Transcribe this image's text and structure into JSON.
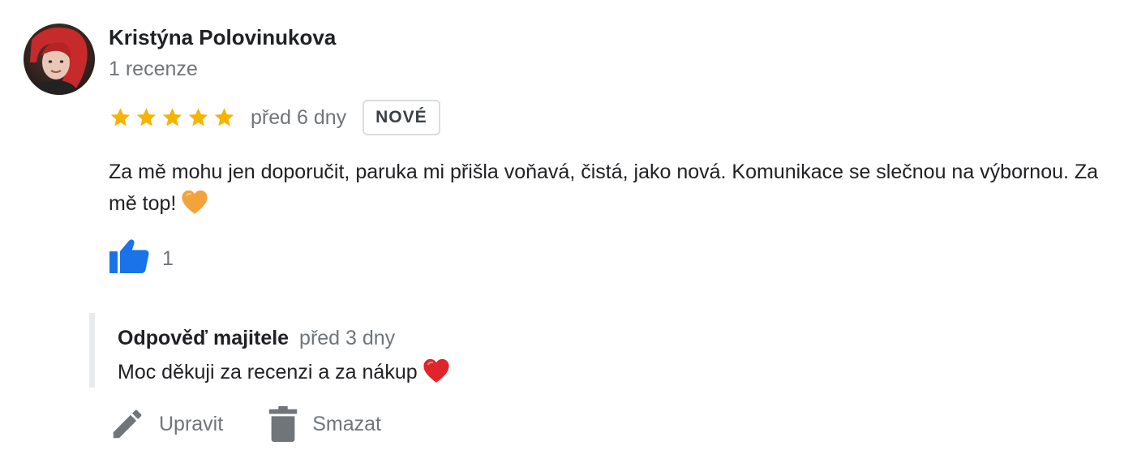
{
  "review": {
    "reviewer_name": "Kristýna Polovinukova",
    "review_count": "1 recenze",
    "rating": 5,
    "date": "před 6 dny",
    "badge": "NOVÉ",
    "text": "Za mě mohu jen doporučit, paruka mi přišla voňavá, čistá, jako nová. Komunikace se slečnou na výbornou. Za mě top!",
    "emoji": "orange-heart",
    "likes": "1"
  },
  "owner_reply": {
    "label": "Odpověď majitele",
    "date": "před 3 dny",
    "text": "Moc děkuji za recenzi a za nákup",
    "emoji": "red-heart"
  },
  "actions": {
    "edit_label": "Upravit",
    "delete_label": "Smazat"
  },
  "icons": {
    "star": "star-icon",
    "like": "thumbs-up-icon",
    "edit": "pencil-icon",
    "delete": "trash-icon"
  },
  "colors": {
    "star": "#f4b400",
    "like": "#1a73e8",
    "secondary_text": "#70757a",
    "primary_text": "#202124",
    "icon_gray": "#70757a",
    "orange_heart": "#f4a23b",
    "red_heart": "#e0242c"
  }
}
